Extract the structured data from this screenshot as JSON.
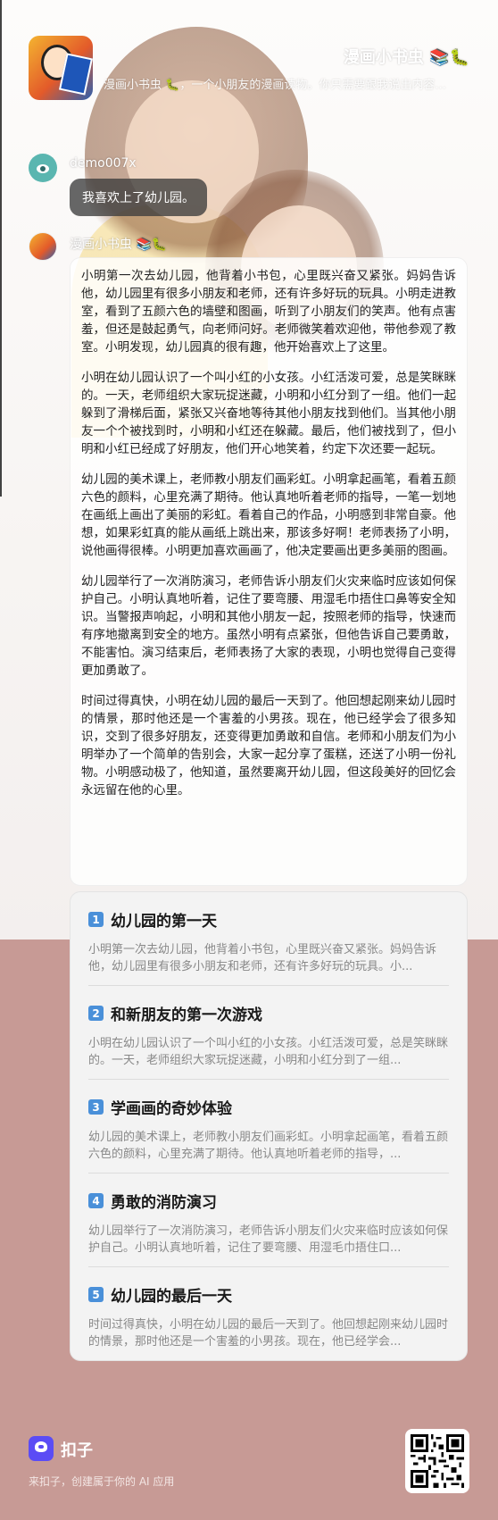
{
  "header": {
    "app_title": "漫画小书虫 📚🐛",
    "app_description": "漫画小书虫 🐛，一个小朋友的漫画读物。你只需要跟我说出内容..."
  },
  "conversation": {
    "user": {
      "name": "demo007x",
      "message": "我喜欢上了幼儿园。"
    },
    "bot": {
      "name": "漫画小书虫 📚🐛",
      "paragraphs": [
        "小明第一次去幼儿园，他背着小书包，心里既兴奋又紧张。妈妈告诉他，幼儿园里有很多小朋友和老师，还有许多好玩的玩具。小明走进教室，看到了五颜六色的墙壁和图画，听到了小朋友们的笑声。他有点害羞，但还是鼓起勇气，向老师问好。老师微笑着欢迎他，带他参观了教室。小明发现，幼儿园真的很有趣，他开始喜欢上了这里。",
        "小明在幼儿园认识了一个叫小红的小女孩。小红活泼可爱，总是笑眯眯的。一天，老师组织大家玩捉迷藏，小明和小红分到了一组。他们一起躲到了滑梯后面，紧张又兴奋地等待其他小朋友找到他们。当其他小朋友一个个被找到时，小明和小红还在躲藏。最后，他们被找到了，但小明和小红已经成了好朋友，他们开心地笑着，约定下次还要一起玩。",
        "幼儿园的美术课上，老师教小朋友们画彩虹。小明拿起画笔，看着五颜六色的颜料，心里充满了期待。他认真地听着老师的指导，一笔一划地在画纸上画出了美丽的彩虹。看着自己的作品，小明感到非常自豪。他想，如果彩虹真的能从画纸上跳出来，那该多好啊！老师表扬了小明，说他画得很棒。小明更加喜欢画画了，他决定要画出更多美丽的图画。",
        "幼儿园举行了一次消防演习，老师告诉小朋友们火灾来临时应该如何保护自己。小明认真地听着，记住了要弯腰、用湿毛巾捂住口鼻等安全知识。当警报声响起，小明和其他小朋友一起，按照老师的指导，快速而有序地撤离到安全的地方。虽然小明有点紧张，但他告诉自己要勇敢，不能害怕。演习结束后，老师表扬了大家的表现，小明也觉得自己变得更加勇敢了。",
        "时间过得真快，小明在幼儿园的最后一天到了。他回想起刚来幼儿园时的情景，那时他还是一个害羞的小男孩。现在，他已经学会了很多知识，交到了很多好朋友，还变得更加勇敢和自信。老师和小朋友们为小明举办了一个简单的告别会，大家一起分享了蛋糕，还送了小明一份礼物。小明感动极了，他知道，虽然要离开幼儿园，但这段美好的回忆会永远留在他的心里。"
      ],
      "chapters": [
        {
          "num": "1",
          "title": "幼儿园的第一天",
          "excerpt": "小明第一次去幼儿园，他背着小书包，心里既兴奋又紧张。妈妈告诉他，幼儿园里有很多小朋友和老师，还有许多好玩的玩具。小..."
        },
        {
          "num": "2",
          "title": "和新朋友的第一次游戏",
          "excerpt": "小明在幼儿园认识了一个叫小红的小女孩。小红活泼可爱，总是笑眯眯的。一天，老师组织大家玩捉迷藏，小明和小红分到了一组..."
        },
        {
          "num": "3",
          "title": "学画画的奇妙体验",
          "excerpt": "幼儿园的美术课上，老师教小朋友们画彩虹。小明拿起画笔，看着五颜六色的颜料，心里充满了期待。他认真地听着老师的指导，..."
        },
        {
          "num": "4",
          "title": "勇敢的消防演习",
          "excerpt": "幼儿园举行了一次消防演习，老师告诉小朋友们火灾来临时应该如何保护自己。小明认真地听着，记住了要弯腰、用湿毛巾捂住口..."
        },
        {
          "num": "5",
          "title": "幼儿园的最后一天",
          "excerpt": "时间过得真快，小明在幼儿园的最后一天到了。他回想起刚来幼儿园时的情景，那时他还是一个害羞的小男孩。现在，他已经学会..."
        }
      ]
    }
  },
  "footer": {
    "brand_name": "扣子",
    "slogan": "来扣子，创建属于你的 AI 应用",
    "qr_icon": "qr-code-icon"
  },
  "colors": {
    "footer_background": "#c79a95",
    "brand_accent": "#5b4cf5",
    "chapter_badge": "#4a90d9"
  }
}
